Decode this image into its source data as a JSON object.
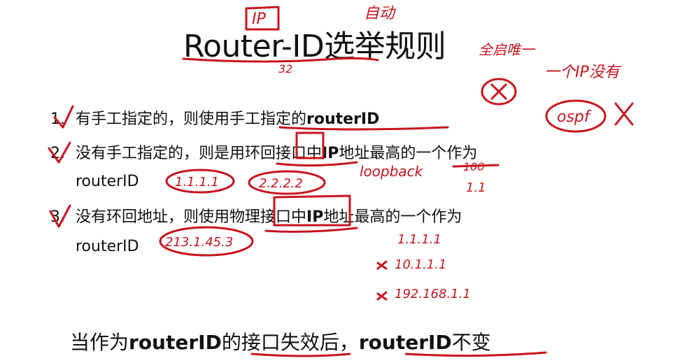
{
  "title": "Router-ID选举规则",
  "rules": [
    {
      "number": "1.",
      "pre": "有手工指定的，则使用手工指定的",
      "bold": "routerID",
      "post": ""
    },
    {
      "number": "2.",
      "pre": "没有手工指定的，则是用环回接口中",
      "bold": "IP",
      "post": "地址最高的一个作为",
      "cont": "routerID"
    },
    {
      "number": "3.",
      "pre": "没有环回地址，则使用物理接口中",
      "bold": "IP",
      "post": "地址最高的一个作为",
      "cont": "routerID"
    }
  ],
  "footer": {
    "t1": "当作为",
    "b1": "routerID",
    "t2": "的接口失效后，",
    "b2": "routerID",
    "t3": "不变"
  },
  "annotations": {
    "ip_box": "IP",
    "auto": "自动",
    "bits": "32",
    "all_enable": "全启唯一",
    "no_ip": "一个IP没有",
    "ospf": "ospf",
    "loopback": "loopback",
    "rid_a": "1.1.1.1",
    "rid_b": "2.2.2.2",
    "rid_c": "100",
    "rid_d": "1.1",
    "phys_ip": "213.1.45.3",
    "list_a": "1.1.1.1",
    "list_b": "10.1.1.1",
    "list_c": "192.168.1.1"
  },
  "colors": {
    "ink": "#c8141e",
    "text": "#111111"
  }
}
